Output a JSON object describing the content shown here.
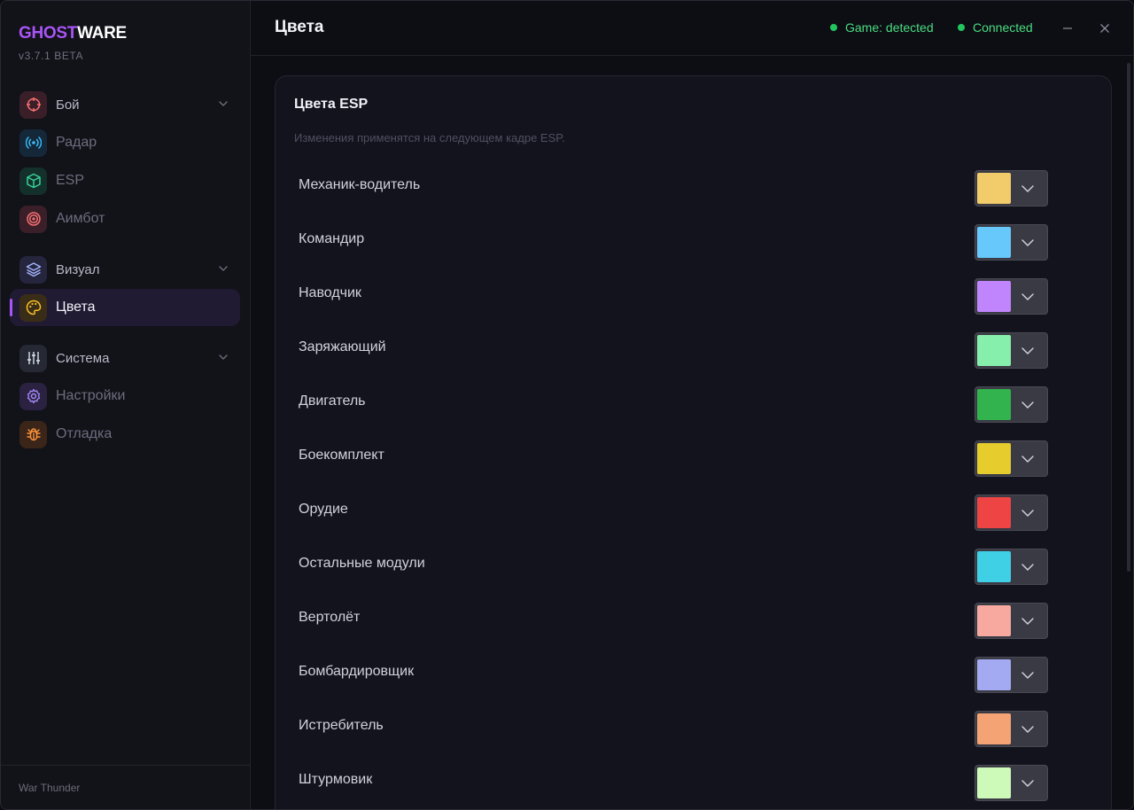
{
  "brand": {
    "part1": "GHOST",
    "part2": "WARE",
    "version": "v3.7.1 BETA"
  },
  "nav": {
    "groups": [
      {
        "label": "Бой",
        "icon": "crosshair-icon",
        "color": "#f87171",
        "bg": "#3a1f28",
        "items": [
          {
            "label": "Радар",
            "icon": "radar-icon",
            "color": "#38bdf8",
            "bg": "#15283a"
          },
          {
            "label": "ESP",
            "icon": "cube-icon",
            "color": "#34d399",
            "bg": "#14302a"
          },
          {
            "label": "Аимбот",
            "icon": "target-icon",
            "color": "#f87171",
            "bg": "#3a1f28"
          }
        ]
      },
      {
        "label": "Визуал",
        "icon": "layers-icon",
        "color": "#a5b4fc",
        "bg": "#25253d",
        "items": [
          {
            "label": "Цвета",
            "icon": "palette-icon",
            "color": "#fbbf24",
            "bg": "#3a2d18",
            "active": true
          }
        ]
      },
      {
        "label": "Система",
        "icon": "sliders-icon",
        "color": "#cbd5e1",
        "bg": "#262833",
        "items": [
          {
            "label": "Настройки",
            "icon": "gear-icon",
            "color": "#a78bfa",
            "bg": "#2a2240"
          },
          {
            "label": "Отладка",
            "icon": "bug-icon",
            "color": "#fb923c",
            "bg": "#3a2518"
          }
        ]
      }
    ]
  },
  "footer": {
    "label": "War Thunder"
  },
  "header": {
    "title": "Цвета",
    "status_game": "Game: detected",
    "status_conn": "Connected",
    "minimize_icon": "minimize-icon",
    "close_icon": "close-icon"
  },
  "card": {
    "title": "Цвета ESP",
    "subtitle": "Изменения применятся на следующем кадре ESP.",
    "rows": [
      {
        "label": "Механик-водитель",
        "color": "#f2cc6b"
      },
      {
        "label": "Командир",
        "color": "#67c8fb"
      },
      {
        "label": "Наводчик",
        "color": "#c084fc"
      },
      {
        "label": "Заряжающий",
        "color": "#86efac"
      },
      {
        "label": "Двигатель",
        "color": "#32b34e"
      },
      {
        "label": "Боекомплект",
        "color": "#e6cc2c"
      },
      {
        "label": "Орудие",
        "color": "#ef4444"
      },
      {
        "label": "Остальные модули",
        "color": "#3fd0e6"
      },
      {
        "label": "Вертолёт",
        "color": "#f7a9a0"
      },
      {
        "label": "Бомбардировщик",
        "color": "#a3aaf2"
      },
      {
        "label": "Истребитель",
        "color": "#f4a474"
      },
      {
        "label": "Штурмовик",
        "color": "#cdfab8"
      }
    ]
  }
}
